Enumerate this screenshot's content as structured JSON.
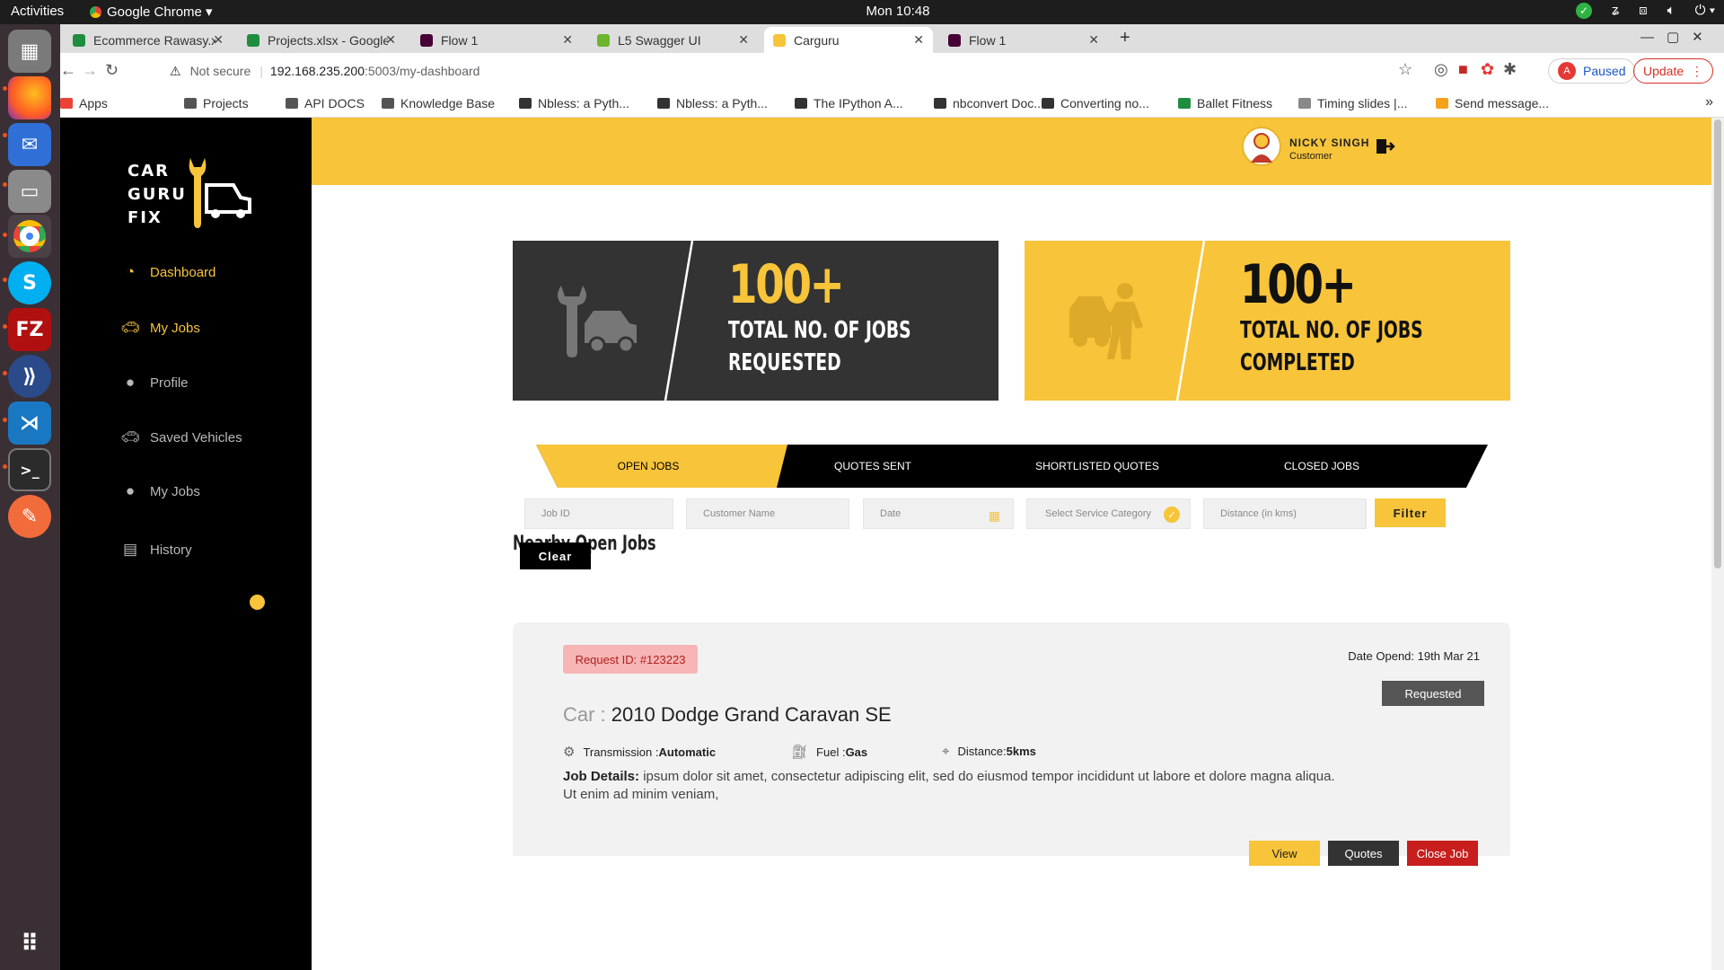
{
  "os": {
    "activities": "Activities",
    "app_name": "Google Chrome",
    "clock": "Mon 10:48"
  },
  "browser": {
    "tabs": [
      {
        "label": "Ecommerce Rawasy.xlsx -",
        "color": "#1e8e3e"
      },
      {
        "label": "Projects.xlsx - Google She",
        "color": "#1e8e3e"
      },
      {
        "label": "Flow 1",
        "color": "#470137"
      },
      {
        "label": "L5 Swagger UI",
        "color": "#6cb52d"
      },
      {
        "label": "Carguru",
        "color": "#f7c43a"
      },
      {
        "label": "Flow 1",
        "color": "#470137"
      }
    ],
    "security_label": "Not secure",
    "url_host": "192.168.235.200",
    "url_path": ":5003/my-dashboard",
    "profile_label": "Paused",
    "profile_initial": "A",
    "update_label": "Update",
    "bookmarks": [
      "Apps",
      "Projects",
      "API DOCS",
      "Knowledge Base",
      "Nbless: a Pyth...",
      "Nbless: a Pyth...",
      "The IPython A...",
      "nbconvert Doc...",
      "Converting no...",
      "Ballet Fitness",
      "Timing slides |...",
      "Send message..."
    ]
  },
  "sidebar": {
    "logo_lines": [
      "CAR",
      "GURU",
      "FIX"
    ],
    "items": [
      {
        "label": "Dashboard",
        "icon": "dashboard-icon"
      },
      {
        "label": "My Jobs",
        "icon": "car-icon"
      },
      {
        "label": "Profile",
        "icon": "user-icon"
      },
      {
        "label": "Saved Vehicles",
        "icon": "car-icon"
      },
      {
        "label": "My Jobs",
        "icon": "user-icon"
      },
      {
        "label": "History",
        "icon": "document-icon"
      }
    ]
  },
  "header": {
    "user_name": "NICKY SINGH",
    "user_role": "Customer"
  },
  "stats": [
    {
      "value": "100+",
      "label_line1": "TOTAL NO. OF JOBS",
      "label_line2": "REQUESTED"
    },
    {
      "value": "100+",
      "label_line1": "TOTAL NO. OF JOBS",
      "label_line2": "COMPLETED"
    }
  ],
  "job_tabs": [
    "OPEN JOBS",
    "QUOTES SENT",
    "SHORTLISTED QUOTES",
    "CLOSED JOBS"
  ],
  "section_title": "Nearby Open Jobs",
  "filters": {
    "job_id": "Job ID",
    "customer_name": "Customer Name",
    "date": "Date",
    "category": "Select Service Category",
    "distance": "Distance (in kms)",
    "filter_button": "Filter",
    "clear_button": "Clear"
  },
  "job": {
    "request_id": "Request ID: #123223",
    "date_opened": "Date Opend: 19th Mar 21",
    "status": "Requested",
    "car_prefix": "Car : ",
    "car_name": "2010 Dodge Grand Caravan SE",
    "transmission_label": "Transmission : ",
    "transmission_value": "Automatic",
    "fuel_label": "Fuel : ",
    "fuel_value": "Gas",
    "distance_label": "Distance: ",
    "distance_value": "5kms",
    "details_label": "Job Details: ",
    "details_text": "ipsum dolor sit amet, consectetur adipiscing elit, sed do eiusmod tempor incididunt ut labore et dolore magna aliqua. Ut enim ad minim veniam,",
    "view_button": "View",
    "quotes_button": "Quotes",
    "close_button": "Close Job"
  },
  "colors": {
    "brand_yellow": "#f7c43a",
    "dark": "#333333",
    "danger": "#c81e1e"
  }
}
